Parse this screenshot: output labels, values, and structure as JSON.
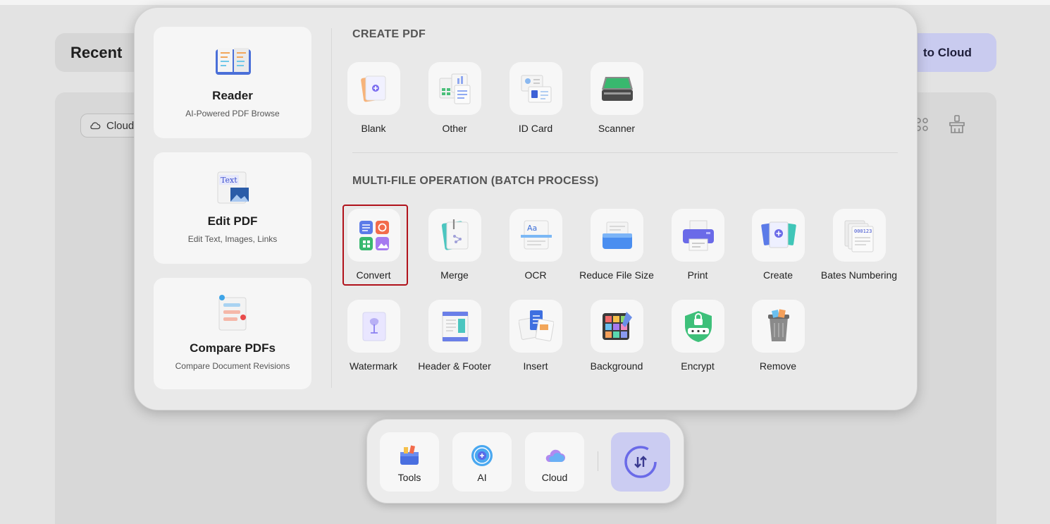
{
  "background": {
    "recent_title": "Recent",
    "upload_button_label": "to Cloud",
    "cloud_filter_label": "Cloud",
    "accent_color": "#c9cbef"
  },
  "cards": [
    {
      "title": "Reader",
      "subtitle": "AI-Powered PDF Browse",
      "icon": "book-icon"
    },
    {
      "title": "Edit PDF",
      "subtitle": "Edit Text, Images, Links",
      "icon": "edit-text-icon"
    },
    {
      "title": "Compare PDFs",
      "subtitle": "Compare Document Revisions",
      "icon": "compare-icon"
    }
  ],
  "create_pdf": {
    "title": "CREATE PDF",
    "tools": [
      {
        "label": "Blank",
        "icon": "blank-icon"
      },
      {
        "label": "Other",
        "icon": "other-files-icon"
      },
      {
        "label": "ID Card",
        "icon": "id-card-icon"
      },
      {
        "label": "Scanner",
        "icon": "scanner-icon"
      }
    ]
  },
  "batch": {
    "title": "MULTI-FILE OPERATION (BATCH PROCESS)",
    "tools": [
      {
        "label": "Convert",
        "icon": "convert-icon"
      },
      {
        "label": "Merge",
        "icon": "merge-icon"
      },
      {
        "label": "OCR",
        "icon": "ocr-icon"
      },
      {
        "label": "Reduce File Size",
        "icon": "reduce-size-icon"
      },
      {
        "label": "Print",
        "icon": "printer-icon"
      },
      {
        "label": "Create",
        "icon": "create-icon"
      },
      {
        "label": "Bates Numbering",
        "icon": "bates-numbering-icon"
      },
      {
        "label": "Watermark",
        "icon": "watermark-icon"
      },
      {
        "label": "Header & Footer",
        "icon": "header-footer-icon"
      },
      {
        "label": "Insert",
        "icon": "insert-icon"
      },
      {
        "label": "Background",
        "icon": "background-icon"
      },
      {
        "label": "Encrypt",
        "icon": "shield-lock-icon"
      },
      {
        "label": "Remove",
        "icon": "trash-icon"
      }
    ]
  },
  "dock": {
    "items": [
      {
        "label": "Tools",
        "icon": "toolbox-icon"
      },
      {
        "label": "AI",
        "icon": "ai-icon"
      },
      {
        "label": "Cloud",
        "icon": "cloud-icon"
      }
    ],
    "active_icon": "switch-icon"
  }
}
